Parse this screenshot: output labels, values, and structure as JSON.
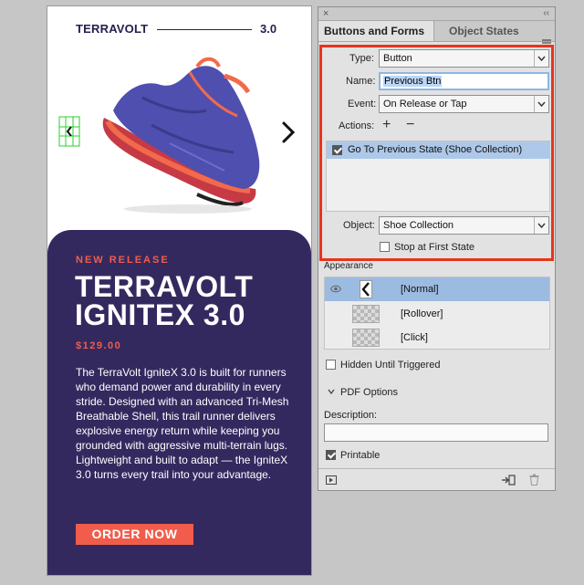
{
  "artboard": {
    "brand": "TERRAVOLT",
    "version": "3.0",
    "new_release": "NEW RELEASE",
    "product_line1": "TERRAVOLT",
    "product_line2": "IGNITEX 3.0",
    "price": "$129.00",
    "description": "The TerraVolt IgniteX 3.0 is built for runners who demand power and durability in every stride. Designed with an advanced Tri-Mesh Breathable Shell, this trail runner delivers explosive energy return while keeping you grounded with aggressive multi-terrain lugs. Lightweight and built to adapt — the IgniteX 3.0 turns every trail into your advantage.",
    "order_button": "ORDER NOW"
  },
  "panel": {
    "close_glyph": "×",
    "collapse_glyph": "‹‹",
    "tabs": [
      "Buttons and Forms",
      "Object States"
    ],
    "type_label": "Type:",
    "type_value": "Button",
    "name_label": "Name:",
    "name_value": "Previous Btn",
    "event_label": "Event:",
    "event_value": "On Release or Tap",
    "actions_label": "Actions:",
    "add_glyph": "+",
    "remove_glyph": "−",
    "action_item": "Go To Previous State (Shoe Collection)",
    "action_checked": true,
    "object_label": "Object:",
    "object_value": "Shoe Collection",
    "stop_label": "Stop at First State",
    "stop_checked": false,
    "appearance_heading": "Appearance",
    "appearance_states": [
      "[Normal]",
      "[Rollover]",
      "[Click]"
    ],
    "hidden_label": "Hidden Until Triggered",
    "hidden_checked": false,
    "pdf_options": "PDF Options",
    "description_label": "Description:",
    "description_value": "",
    "printable_label": "Printable",
    "printable_checked": true
  },
  "colors": {
    "brand_navy": "#25204f",
    "panel_purple": "#34295f",
    "accent_coral": "#f15c4b",
    "highlight_red": "#e8341c",
    "selection_blue": "#adc8e8"
  }
}
